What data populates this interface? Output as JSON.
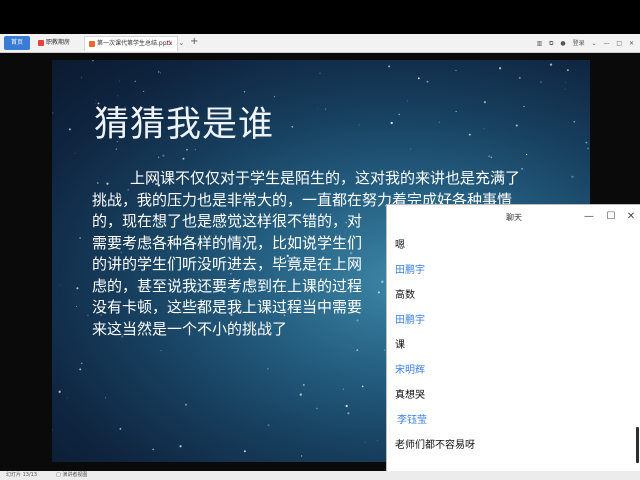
{
  "browser": {
    "tabs": [
      {
        "label": "首页",
        "active": false
      },
      {
        "label": "职教期房",
        "active": false
      },
      {
        "label": "第一次课代第学生总结.pptx",
        "active": true
      }
    ],
    "tab_controls": [
      "⚠",
      "⌄"
    ],
    "add_tab": "+",
    "right_icons": [
      "▥",
      "⧉",
      "●",
      "登录",
      "⌄",
      "—",
      "□",
      "✕"
    ]
  },
  "slide": {
    "title": "猜猜我是谁",
    "body_lines": [
      "上网课不仅仅对于学生是陌生的，这对我的来讲也是充满了",
      "挑战，我的压力也是非常大的，一直都在努力着完成好各种事情",
      "的，现在想了也是感觉这样很不错的，对",
      "需要考虑各种各样的情况，比如说学生们",
      "的讲的学生们听没听进去，毕竟是在上网",
      "虑的，甚至说我还要考虑到在上课的过程",
      "没有卡顿，这些都是我上课过程当中需要",
      "来这当然是一个不小的挑战了"
    ]
  },
  "chat": {
    "title": "聊天",
    "window_controls": {
      "minimize": "—",
      "maximize": "☐",
      "close": "✕"
    },
    "messages": [
      {
        "type": "text",
        "text": "嗯"
      },
      {
        "type": "sender",
        "text": "田鹏宇"
      },
      {
        "type": "text",
        "text": "高数"
      },
      {
        "type": "sender",
        "text": "田鹏宇"
      },
      {
        "type": "text",
        "text": "课"
      },
      {
        "type": "sender",
        "text": "宋明辉"
      },
      {
        "type": "text",
        "text": "真想哭"
      },
      {
        "type": "sender",
        "text": "李钰莹"
      },
      {
        "type": "text",
        "text": "老师们都不容易呀"
      }
    ]
  },
  "status_bar": {
    "left": "幻灯片 13/13",
    "middle": "□ 演讲者视图"
  }
}
